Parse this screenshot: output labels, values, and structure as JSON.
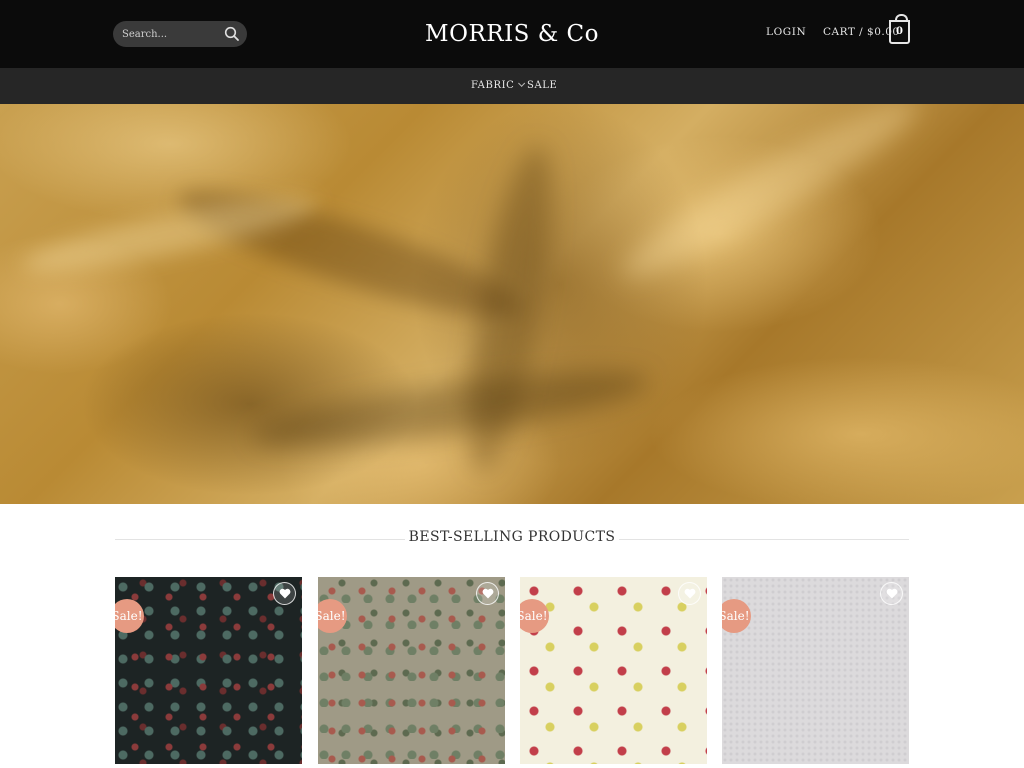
{
  "header": {
    "search": {
      "placeholder": "Search...",
      "icon": "search-icon"
    },
    "logo": "MORRIS & Co",
    "login_label": "LOGIN",
    "cart_label": "CART / $0.00",
    "cart_count": "0"
  },
  "nav": {
    "items": [
      {
        "label": "FABRIC",
        "has_dropdown": true
      },
      {
        "label": "SALE",
        "has_dropdown": false
      }
    ]
  },
  "hero": {
    "description": "gold satin fabric"
  },
  "section": {
    "title": "BEST-SELLING PRODUCTS"
  },
  "products": [
    {
      "badge": "Sale!",
      "wishlist_icon": "heart-icon"
    },
    {
      "badge": "Sale!",
      "wishlist_icon": "heart-icon"
    },
    {
      "badge": "Sale!",
      "wishlist_icon": "heart-icon"
    },
    {
      "badge": "Sale!",
      "wishlist_icon": "heart-icon"
    }
  ],
  "colors": {
    "header_bg": "#0b0b0b",
    "nav_bg": "#262626",
    "sale_badge": "#e69a82",
    "hero_gold": "#c9a050"
  }
}
